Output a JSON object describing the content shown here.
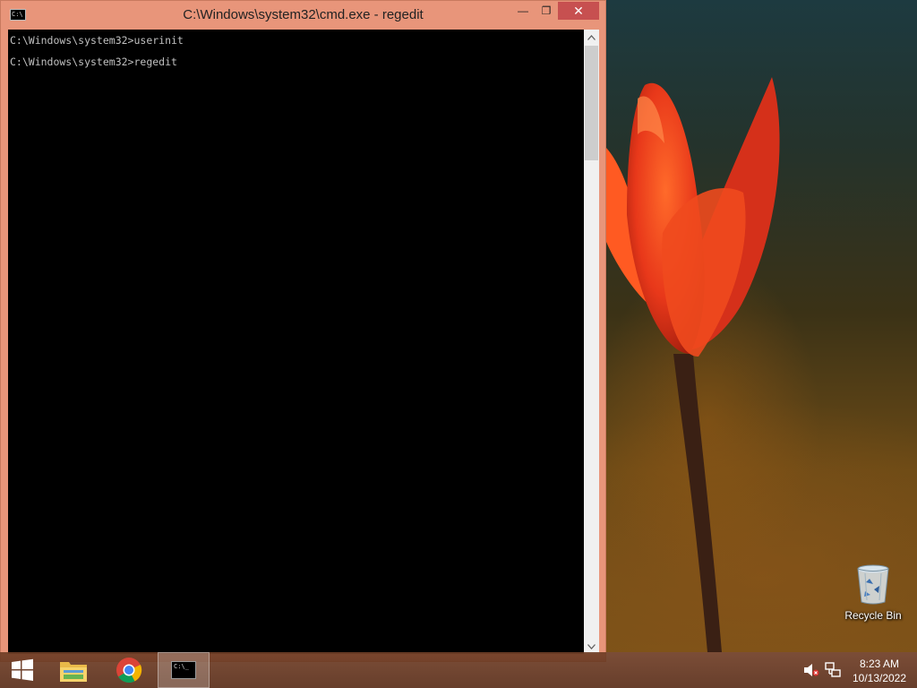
{
  "window": {
    "title": "C:\\Windows\\system32\\cmd.exe - regedit",
    "icon_text": "C:\\",
    "minimize_glyph": "—",
    "restore_glyph": "❐",
    "close_glyph": "✕"
  },
  "console": {
    "lines": [
      "C:\\Windows\\system32>userinit",
      "C:\\Windows\\system32>regedit"
    ],
    "text_color": "#c0c0c0",
    "background": "#000000"
  },
  "desktop": {
    "icons": [
      {
        "label": "Recycle Bin",
        "icon": "recycle-bin-icon"
      }
    ]
  },
  "taskbar": {
    "buttons": [
      {
        "name": "start",
        "icon": "windows-logo-icon"
      },
      {
        "name": "file-explorer",
        "icon": "folder-icon"
      },
      {
        "name": "chrome",
        "icon": "chrome-icon"
      },
      {
        "name": "command-prompt",
        "icon": "cmd-icon",
        "active": true,
        "icon_text": "C:\\_"
      }
    ],
    "tray": {
      "volume": "volume-muted-icon",
      "network": "network-icon",
      "time": "8:23 AM",
      "date": "10/13/2022"
    }
  },
  "colors": {
    "window_frame": "#e8957a",
    "close_button": "#c75050",
    "taskbar": "#6b3a24"
  }
}
